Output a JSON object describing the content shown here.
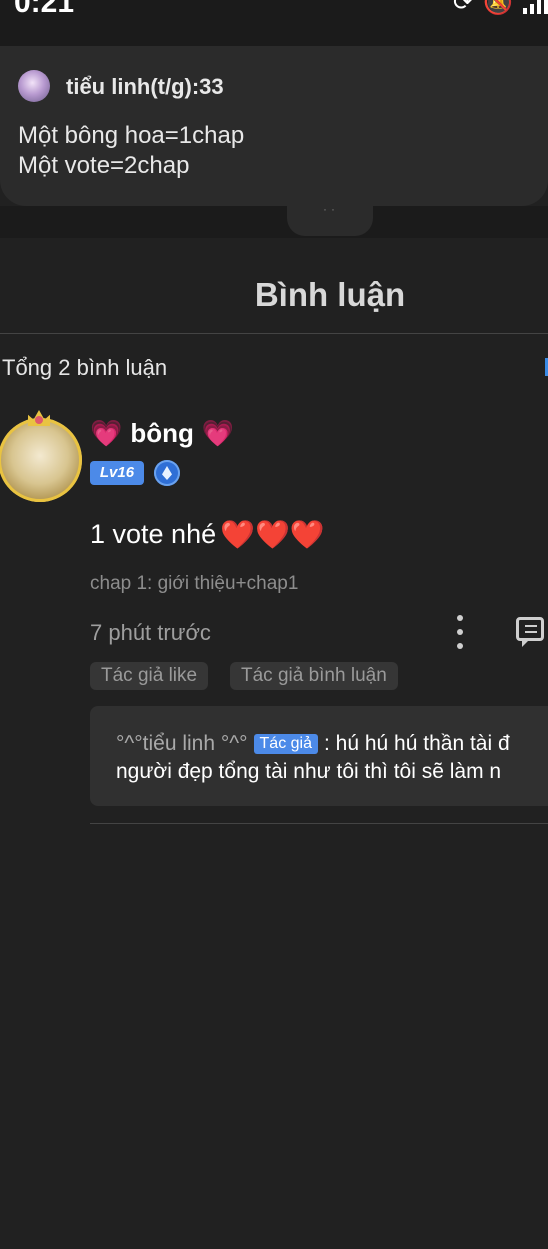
{
  "status_bar": {
    "time": "0:21",
    "icons": [
      "sync-icon",
      "bell-off-icon",
      "signal-icon"
    ]
  },
  "notification": {
    "title": "tiểu linh(t/g):33",
    "line1": "Một bông hoa=1chap",
    "line2": "Một vote=2chap"
  },
  "header": {
    "title": "Bình luận"
  },
  "comments_summary": {
    "total": "Tổng 2 bình luận"
  },
  "comment": {
    "username": "bông",
    "heart_emoji": "💗",
    "level": "Lv16",
    "text": "1 vote nhé",
    "hearts": "❤️❤️❤️",
    "chapter": "chap 1: giới thiệu+chap1",
    "time": "7 phút trước",
    "chips": [
      "Tác giả like",
      "Tác giả bình luận"
    ],
    "reply": {
      "author": "°^°tiểu linh °^°",
      "author_tag": "Tác giả",
      "line1_text": ": hú hú hú thần tài đ",
      "line2_text": "người đẹp tổng tài như tôi thì tôi sẽ làm n"
    }
  },
  "colors": {
    "background": "#212121",
    "accent": "#4c8ae8",
    "heart_pink": "#f0508c",
    "muted_text": "#9e9e9e"
  }
}
